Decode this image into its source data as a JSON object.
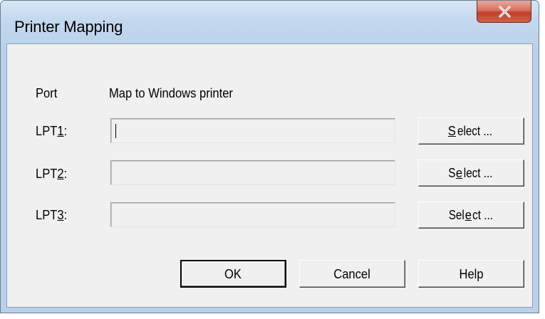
{
  "window": {
    "title": "Printer Mapping"
  },
  "headers": {
    "port": "Port",
    "map_to": "Map to Windows printer"
  },
  "rows": [
    {
      "label_pre": "LPT",
      "label_mnemonic": "1",
      "label_post": ":",
      "value": "",
      "select_pre": "",
      "select_mnemonic": "S",
      "select_post": "elect ..."
    },
    {
      "label_pre": "LPT",
      "label_mnemonic": "2",
      "label_post": ":",
      "value": "",
      "select_pre": "S",
      "select_mnemonic": "e",
      "select_post": "lect ..."
    },
    {
      "label_pre": "LPT",
      "label_mnemonic": "3",
      "label_post": ":",
      "value": "",
      "select_pre": "Sel",
      "select_mnemonic": "e",
      "select_post": "ct ..."
    }
  ],
  "buttons": {
    "ok": "OK",
    "cancel": "Cancel",
    "help": "Help"
  },
  "icons": {
    "close": "close-icon"
  }
}
